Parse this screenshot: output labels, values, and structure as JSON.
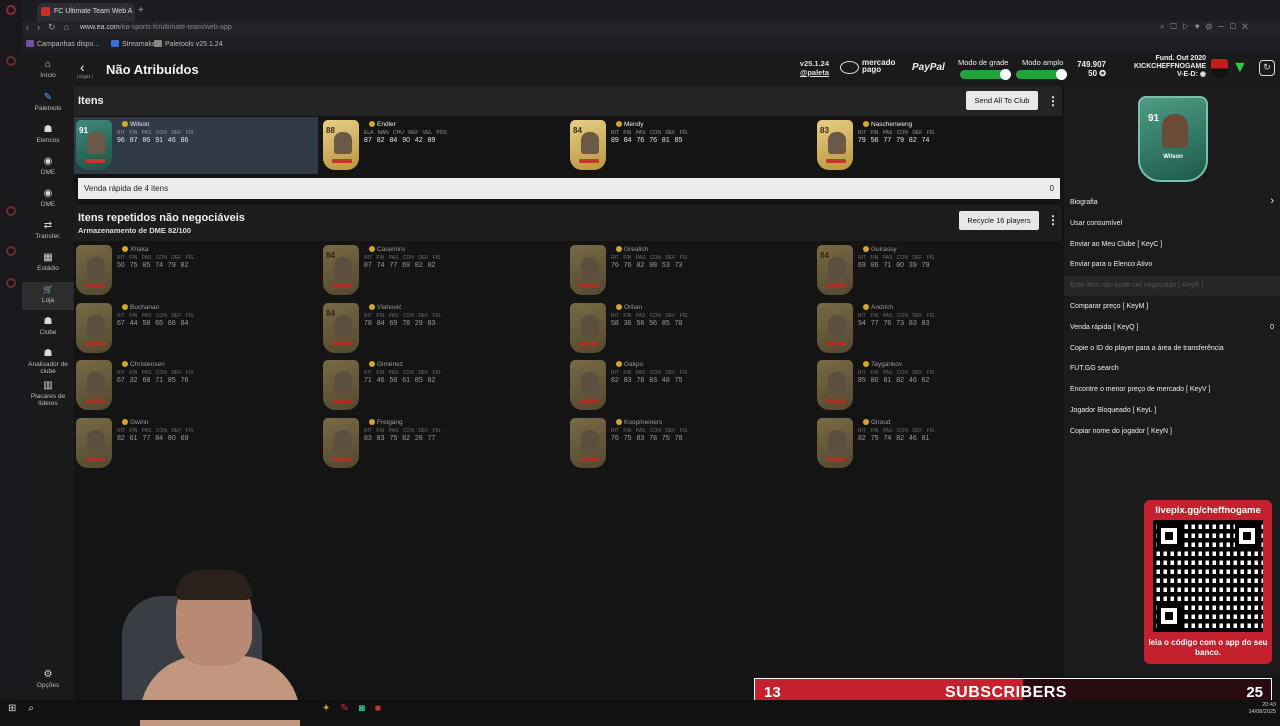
{
  "browser": {
    "tab_title": "FC Ultimate Team Web A",
    "new_tab": "+",
    "url_domain": "www.ea.com",
    "url_path": "/ea-sports-fc/ultimate-team/web-app",
    "bookmarks": [
      "Campanhas dispo...",
      "Streamaker",
      "Paletools v25.1.24"
    ]
  },
  "nav": {
    "back_sub": "[ Digit1 ]",
    "items": [
      {
        "icon": "⌂",
        "label": "Início"
      },
      {
        "icon": "✎",
        "label": "Paletools"
      },
      {
        "icon": "☗",
        "label": "Elencos"
      },
      {
        "icon": "◉",
        "label": "DME"
      },
      {
        "icon": "◉",
        "label": "DME"
      },
      {
        "icon": "⇄",
        "label": "Transfer."
      },
      {
        "icon": "▦",
        "label": "Estádio"
      },
      {
        "icon": "🛒",
        "label": "Loja"
      },
      {
        "icon": "☗",
        "label": "Clube"
      },
      {
        "icon": "☗",
        "label": "Analisador de clube"
      },
      {
        "icon": "▥",
        "label": "Placares de líderes"
      }
    ],
    "options": {
      "icon": "⚙",
      "label": "Opções"
    }
  },
  "header": {
    "title": "Não Atribuídos",
    "version": "v25.1.24",
    "handle": "@paleta",
    "mercadopago": "mercado pago",
    "paypal": "PayPal",
    "grid_mode": "Modo de grade",
    "wide_mode": "Modo amplo",
    "coins": "749.907",
    "points": "50",
    "fund": "Fund. Out 2020",
    "username": "KICKCHEFFNOGAME",
    "record": "V-E-D:"
  },
  "items_section": {
    "title": "Itens",
    "send_all": "Send All To Club",
    "players": [
      {
        "name": "Wilson",
        "ovr": "91",
        "labels": "RIT FIN PAS CON DEF FÍS",
        "stats": "96 87 86 91 46 86",
        "selected": true,
        "green": true
      },
      {
        "name": "Endler",
        "ovr": "88",
        "labels": "ELA MAN CHU REF VEL POS",
        "stats": "87 82 84 90 42 89",
        "selected": false,
        "green": false
      },
      {
        "name": "Mendy",
        "ovr": "84",
        "labels": "RIT FIN PAS CON DEF FÍS",
        "stats": "89 84 76 76 81 85",
        "selected": false,
        "green": false
      },
      {
        "name": "Naschenweng",
        "ovr": "83",
        "labels": "RIT FIN PAS CON DEF FÍS",
        "stats": "79 56 77 79 82 74",
        "selected": false,
        "green": false
      }
    ],
    "quick_sell_label": "Venda rápida de 4 itens",
    "quick_sell_value": "0"
  },
  "duplicates_section": {
    "title": "Itens repetidos não negociáveis",
    "storage": "Armazenamento de DME 82/100",
    "recycle": "Recycle 16 players",
    "labels": "RIT FIN PAS CON DEF FÍS",
    "players": [
      {
        "name": "Xhaka",
        "ovr": "",
        "stats": "50 75 85 74 79 82"
      },
      {
        "name": "Casemiro",
        "ovr": "84",
        "stats": "87 74 77 69 82 82"
      },
      {
        "name": "Grealish",
        "ovr": "",
        "stats": "76 76 82 88 53 73"
      },
      {
        "name": "Guirassy",
        "ovr": "84",
        "stats": "69 86 71 80 39 79"
      },
      {
        "name": "Buchanan",
        "ovr": "",
        "stats": "67 44 58 65 86 84"
      },
      {
        "name": "Vlahović",
        "ovr": "84",
        "stats": "78 84 69 78 29 83"
      },
      {
        "name": "Orban",
        "ovr": "",
        "stats": "58 36 56 56 85 78"
      },
      {
        "name": "Andrich",
        "ovr": "",
        "stats": "54 77 76 73 83 83"
      },
      {
        "name": "Christensen",
        "ovr": "",
        "stats": "67 32 68 71 85 76"
      },
      {
        "name": "Giménez",
        "ovr": "",
        "stats": "71 46 58 61 85 82"
      },
      {
        "name": "Gakpo",
        "ovr": "",
        "stats": "82 83 78 83 48 75"
      },
      {
        "name": "Taygankov",
        "ovr": "",
        "stats": "85 80 81 82 46 62"
      },
      {
        "name": "Gwinn",
        "ovr": "",
        "stats": "82 61 77 84 80 69"
      },
      {
        "name": "Freigang",
        "ovr": "",
        "stats": "83 83 75 82 26 77"
      },
      {
        "name": "Koopmeiners",
        "ovr": "",
        "stats": "76 75 83 78 75 78"
      },
      {
        "name": "Giroud",
        "ovr": "",
        "stats": "82 75 74 82 46 81"
      }
    ]
  },
  "right_panel": {
    "card_ovr": "91",
    "card_name": "Wilson",
    "menu": [
      {
        "label": "Biografia",
        "value": "›",
        "disabled": false,
        "chevron": true
      },
      {
        "label": "Usar consumível",
        "value": "",
        "disabled": false
      },
      {
        "label": "Enviar ao Meu Clube [ KeyC ]",
        "value": "",
        "disabled": false
      },
      {
        "label": "Enviar para o Elenco Ativo",
        "value": "",
        "disabled": false
      },
      {
        "label": "Este item não pode ser negociado [ KeyR ]",
        "value": "",
        "disabled": true
      },
      {
        "label": "Comparar preço [ KeyM ]",
        "value": "",
        "disabled": false
      },
      {
        "label": "Venda rápida [ KeyQ ]",
        "value": "0",
        "disabled": false
      },
      {
        "label": "Copie o ID do player para a área de transferência",
        "value": "",
        "disabled": false
      },
      {
        "label": "FUT.GG search",
        "value": "",
        "disabled": false
      },
      {
        "label": "Encontre o menor preço de mercado [ KeyV ]",
        "value": "",
        "disabled": false
      },
      {
        "label": "Jogador Bloqueado [ KeyL ]",
        "value": "",
        "disabled": false
      },
      {
        "label": "Copiar nome do jogador [ KeyN ]",
        "value": "",
        "disabled": false
      }
    ]
  },
  "overlay": {
    "livepix_title": "livepix.gg/cheffnogame",
    "livepix_caption": "leia o código com o app do seu banco.",
    "subs_current": "13",
    "subs_label": "SUBSCRIBERS",
    "subs_goal": "25",
    "subs_progress": 0.52
  },
  "taskbar": {
    "date": "14/08/2025",
    "time": "20:43"
  }
}
